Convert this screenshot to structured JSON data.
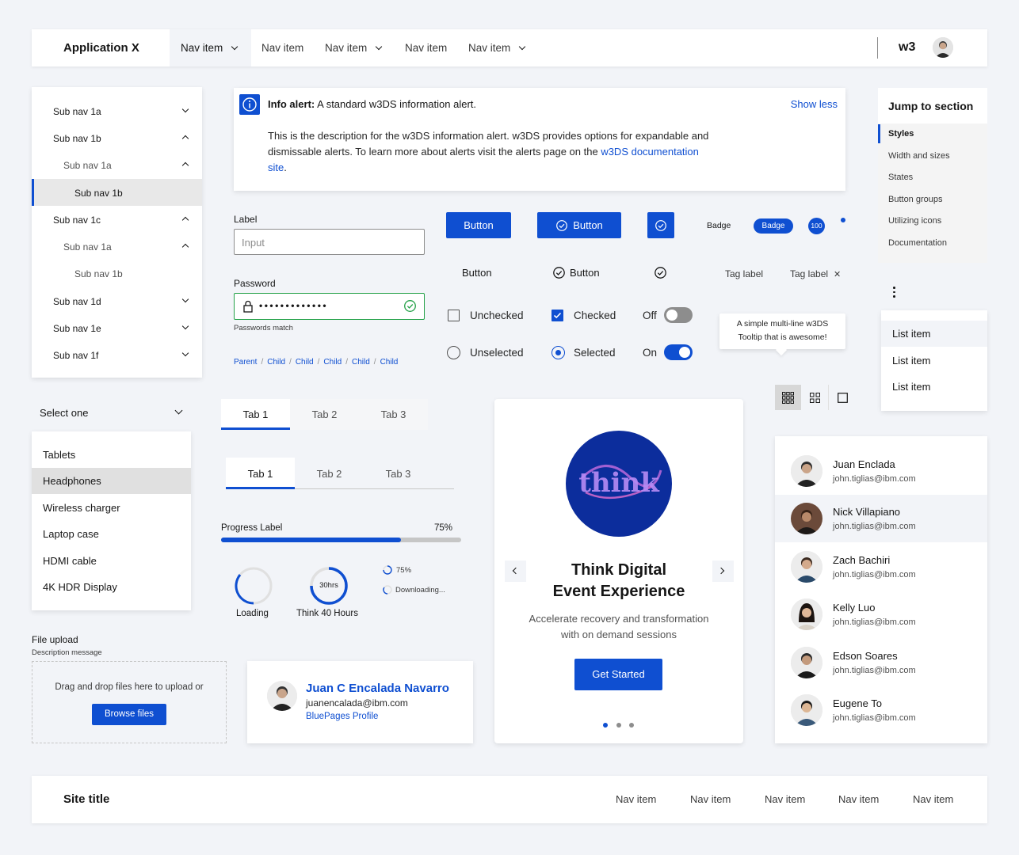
{
  "header": {
    "app_title": "Application X",
    "nav": [
      "Nav item",
      "Nav item",
      "Nav item",
      "Nav item",
      "Nav item"
    ],
    "brand": "w3"
  },
  "sidenav": {
    "items": [
      "Sub nav 1a",
      "Sub nav 1b",
      "Sub nav 1a",
      "Sub nav 1b",
      "Sub nav 1c",
      "Sub nav 1a",
      "Sub nav 1b",
      "Sub nav 1d",
      "Sub nav 1e",
      "Sub nav 1f"
    ]
  },
  "select": {
    "label": "Select one",
    "options": [
      "Tablets",
      "Headphones",
      "Wireless charger",
      "Laptop case",
      "HDMI cable",
      "4K HDR Display"
    ]
  },
  "file_upload": {
    "title": "File upload",
    "description": "Description message",
    "drop_text": "Drag and drop files here to upload or",
    "browse": "Browse files"
  },
  "alert": {
    "title_bold": "Info alert:",
    "title_rest": " A standard w3DS information alert.",
    "show_less": "Show less",
    "desc": "This is the description for the w3DS information alert. w3DS provides options for expandable and dismissable alerts. To learn more about alerts visit the alerts page on the ",
    "link": "w3DS documentation site",
    "desc_end": "."
  },
  "form": {
    "input_label": "Label",
    "input_placeholder": "Input",
    "password_label": "Password",
    "password_value": "•••••••••••••",
    "password_help": "Passwords match",
    "breadcrumb": [
      "Parent",
      "Child",
      "Child",
      "Child",
      "Child",
      "Child"
    ]
  },
  "buttons": {
    "primary": "Button",
    "primary_icon": "Button",
    "ghost": "Button",
    "ghost_icon": "Button",
    "badge_text": "Badge",
    "badge_pill": "Badge",
    "badge_count": "100",
    "tag1": "Tag label",
    "tag2": "Tag label"
  },
  "controls": {
    "unchecked": "Unchecked",
    "checked": "Checked",
    "unselected": "Unselected",
    "selected": "Selected",
    "off": "Off",
    "on": "On"
  },
  "tooltip": {
    "line1": "A simple multi-line w3DS",
    "line2": "Tooltip that is awesome!"
  },
  "tabs1": [
    "Tab 1",
    "Tab 2",
    "Tab 3"
  ],
  "tabs2": [
    "Tab 1",
    "Tab 2",
    "Tab 3"
  ],
  "progress": {
    "label": "Progress Label",
    "value_text": "75%",
    "fraction": 0.75,
    "loading": "Loading",
    "hours_label": "Think 40 Hours",
    "hours_center": "30hrs",
    "small1": "75%",
    "small2": "Downloading..."
  },
  "profile": {
    "name": "Juan C Encalada Navarro",
    "email": "juanencalada@ibm.com",
    "link": "BluePages Profile"
  },
  "carousel": {
    "logo_text": "think",
    "title1": "Think Digital",
    "title2": "Event Experience",
    "sub1": "Accelerate recovery and transformation",
    "sub2": "with on demand sessions",
    "cta": "Get Started"
  },
  "jump": {
    "title": "Jump to section",
    "items": [
      "Styles",
      "Width and sizes",
      "States",
      "Button groups",
      "Utilizing icons",
      "Documentation"
    ]
  },
  "list": [
    "List item",
    "List item",
    "List item"
  ],
  "people": [
    {
      "name": "Juan Enclada",
      "email": "john.tiglias@ibm.com"
    },
    {
      "name": "Nick Villapiano",
      "email": "john.tiglias@ibm.com"
    },
    {
      "name": "Zach Bachiri",
      "email": "john.tiglias@ibm.com"
    },
    {
      "name": "Kelly Luo",
      "email": "john.tiglias@ibm.com"
    },
    {
      "name": "Edson Soares",
      "email": "john.tiglias@ibm.com"
    },
    {
      "name": "Eugene To",
      "email": "john.tiglias@ibm.com"
    }
  ],
  "footer": {
    "site_title": "Site title",
    "nav": [
      "Nav item",
      "Nav item",
      "Nav item",
      "Nav item",
      "Nav item"
    ]
  },
  "colors": {
    "accent": "#0f4fd1",
    "success": "#24a148",
    "background": "#f2f4f8"
  }
}
